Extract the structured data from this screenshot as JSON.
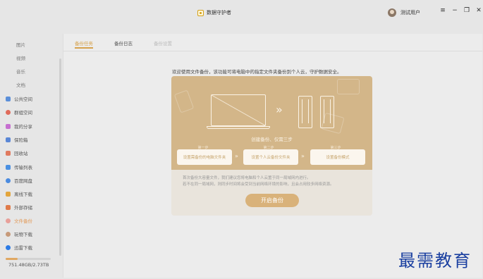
{
  "app": {
    "title": "数据守护者",
    "user": "测试用户",
    "controls": [
      "≡",
      "−",
      "❐",
      "✕"
    ]
  },
  "sidebar": {
    "sub_items": [
      {
        "label": "图片"
      },
      {
        "label": "视频"
      },
      {
        "label": "音乐"
      },
      {
        "label": "文档"
      }
    ],
    "items": [
      {
        "label": "公共空间",
        "icon": "megaphone-icon",
        "color": "#5b8fd9"
      },
      {
        "label": "群组空间",
        "icon": "group-icon",
        "color": "#e06b5b"
      },
      {
        "label": "我的分享",
        "icon": "share-icon",
        "color": "#c66fd0"
      },
      {
        "label": "保险箱",
        "icon": "safe-icon",
        "color": "#5a87d6"
      },
      {
        "label": "回收站",
        "icon": "trash-icon",
        "color": "#e07a5f"
      },
      {
        "label": "传输列表",
        "icon": "transfer-icon",
        "color": "#4a90e2"
      },
      {
        "label": "百度网盘",
        "icon": "cloud-icon",
        "color": "#4b8be0"
      },
      {
        "label": "离线下载",
        "icon": "download-icon",
        "color": "#e3a53c"
      },
      {
        "label": "外部存储",
        "icon": "usb-icon",
        "color": "#e07b4a"
      },
      {
        "label": "文件备份",
        "icon": "backup-icon",
        "color": "#e8a09a",
        "active": true
      },
      {
        "label": "玩物下载",
        "icon": "toy-download-icon",
        "color": "#c79a7a"
      },
      {
        "label": "迅雷下载",
        "icon": "thunder-icon",
        "color": "#2c7be5"
      }
    ],
    "storage": {
      "text": "751.48GB/2.73TB",
      "used_fraction": 0.27
    }
  },
  "tabs": [
    {
      "label": "备份任务",
      "state": "active"
    },
    {
      "label": "备份日志",
      "state": "normal"
    },
    {
      "label": "备份设置",
      "state": "disabled"
    }
  ],
  "main": {
    "intro": "欢迎使用文件备份，该功能可将电脑中的指定文件夹备份到个人云，守护数据安全。",
    "card": {
      "tagline": "创建备份、仅需三步",
      "steps": [
        {
          "label": "第一步",
          "text": "设置需备份的电脑文件夹"
        },
        {
          "label": "第二步",
          "text": "设置个人云备份文件夹"
        },
        {
          "label": "第三步",
          "text": "设置备份模式"
        }
      ],
      "desc1": "首次备份大容量文件，我们建议您将电脑和个人云置于同一局域网内进行。",
      "desc2": "若不在同一局域网，则同步时间将会受到当前网络环境的影响，且会占用较多网络资源。",
      "button": "开启备份"
    }
  },
  "watermark": "最需教育"
}
